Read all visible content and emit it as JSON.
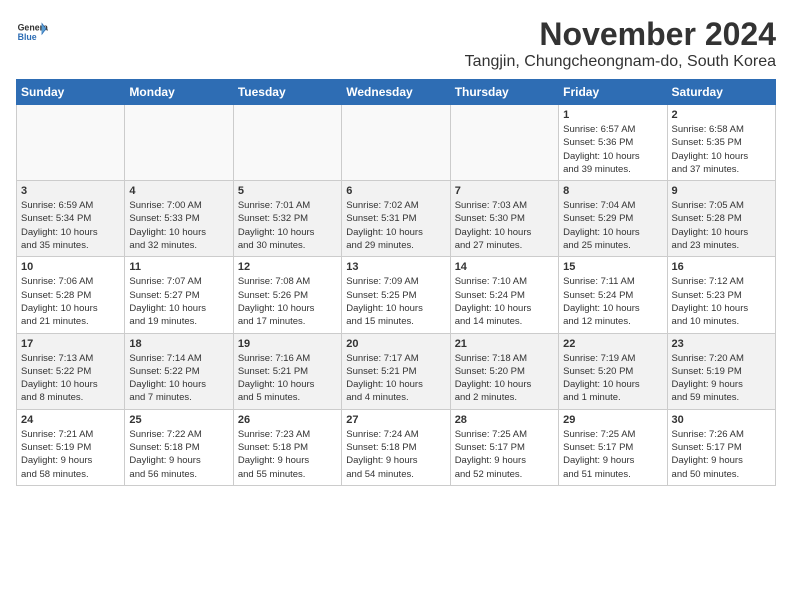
{
  "header": {
    "logo_line1": "General",
    "logo_line2": "Blue",
    "month": "November 2024",
    "location": "Tangjin, Chungcheongnam-do, South Korea"
  },
  "weekdays": [
    "Sunday",
    "Monday",
    "Tuesday",
    "Wednesday",
    "Thursday",
    "Friday",
    "Saturday"
  ],
  "weeks": [
    {
      "row_class": "row-odd",
      "days": [
        {
          "num": "",
          "info": "",
          "empty": true
        },
        {
          "num": "",
          "info": "",
          "empty": true
        },
        {
          "num": "",
          "info": "",
          "empty": true
        },
        {
          "num": "",
          "info": "",
          "empty": true
        },
        {
          "num": "",
          "info": "",
          "empty": true
        },
        {
          "num": "1",
          "info": "Sunrise: 6:57 AM\nSunset: 5:36 PM\nDaylight: 10 hours\nand 39 minutes.",
          "empty": false
        },
        {
          "num": "2",
          "info": "Sunrise: 6:58 AM\nSunset: 5:35 PM\nDaylight: 10 hours\nand 37 minutes.",
          "empty": false
        }
      ]
    },
    {
      "row_class": "row-even",
      "days": [
        {
          "num": "3",
          "info": "Sunrise: 6:59 AM\nSunset: 5:34 PM\nDaylight: 10 hours\nand 35 minutes.",
          "empty": false
        },
        {
          "num": "4",
          "info": "Sunrise: 7:00 AM\nSunset: 5:33 PM\nDaylight: 10 hours\nand 32 minutes.",
          "empty": false
        },
        {
          "num": "5",
          "info": "Sunrise: 7:01 AM\nSunset: 5:32 PM\nDaylight: 10 hours\nand 30 minutes.",
          "empty": false
        },
        {
          "num": "6",
          "info": "Sunrise: 7:02 AM\nSunset: 5:31 PM\nDaylight: 10 hours\nand 29 minutes.",
          "empty": false
        },
        {
          "num": "7",
          "info": "Sunrise: 7:03 AM\nSunset: 5:30 PM\nDaylight: 10 hours\nand 27 minutes.",
          "empty": false
        },
        {
          "num": "8",
          "info": "Sunrise: 7:04 AM\nSunset: 5:29 PM\nDaylight: 10 hours\nand 25 minutes.",
          "empty": false
        },
        {
          "num": "9",
          "info": "Sunrise: 7:05 AM\nSunset: 5:28 PM\nDaylight: 10 hours\nand 23 minutes.",
          "empty": false
        }
      ]
    },
    {
      "row_class": "row-odd",
      "days": [
        {
          "num": "10",
          "info": "Sunrise: 7:06 AM\nSunset: 5:28 PM\nDaylight: 10 hours\nand 21 minutes.",
          "empty": false
        },
        {
          "num": "11",
          "info": "Sunrise: 7:07 AM\nSunset: 5:27 PM\nDaylight: 10 hours\nand 19 minutes.",
          "empty": false
        },
        {
          "num": "12",
          "info": "Sunrise: 7:08 AM\nSunset: 5:26 PM\nDaylight: 10 hours\nand 17 minutes.",
          "empty": false
        },
        {
          "num": "13",
          "info": "Sunrise: 7:09 AM\nSunset: 5:25 PM\nDaylight: 10 hours\nand 15 minutes.",
          "empty": false
        },
        {
          "num": "14",
          "info": "Sunrise: 7:10 AM\nSunset: 5:24 PM\nDaylight: 10 hours\nand 14 minutes.",
          "empty": false
        },
        {
          "num": "15",
          "info": "Sunrise: 7:11 AM\nSunset: 5:24 PM\nDaylight: 10 hours\nand 12 minutes.",
          "empty": false
        },
        {
          "num": "16",
          "info": "Sunrise: 7:12 AM\nSunset: 5:23 PM\nDaylight: 10 hours\nand 10 minutes.",
          "empty": false
        }
      ]
    },
    {
      "row_class": "row-even",
      "days": [
        {
          "num": "17",
          "info": "Sunrise: 7:13 AM\nSunset: 5:22 PM\nDaylight: 10 hours\nand 8 minutes.",
          "empty": false
        },
        {
          "num": "18",
          "info": "Sunrise: 7:14 AM\nSunset: 5:22 PM\nDaylight: 10 hours\nand 7 minutes.",
          "empty": false
        },
        {
          "num": "19",
          "info": "Sunrise: 7:16 AM\nSunset: 5:21 PM\nDaylight: 10 hours\nand 5 minutes.",
          "empty": false
        },
        {
          "num": "20",
          "info": "Sunrise: 7:17 AM\nSunset: 5:21 PM\nDaylight: 10 hours\nand 4 minutes.",
          "empty": false
        },
        {
          "num": "21",
          "info": "Sunrise: 7:18 AM\nSunset: 5:20 PM\nDaylight: 10 hours\nand 2 minutes.",
          "empty": false
        },
        {
          "num": "22",
          "info": "Sunrise: 7:19 AM\nSunset: 5:20 PM\nDaylight: 10 hours\nand 1 minute.",
          "empty": false
        },
        {
          "num": "23",
          "info": "Sunrise: 7:20 AM\nSunset: 5:19 PM\nDaylight: 9 hours\nand 59 minutes.",
          "empty": false
        }
      ]
    },
    {
      "row_class": "row-odd",
      "days": [
        {
          "num": "24",
          "info": "Sunrise: 7:21 AM\nSunset: 5:19 PM\nDaylight: 9 hours\nand 58 minutes.",
          "empty": false
        },
        {
          "num": "25",
          "info": "Sunrise: 7:22 AM\nSunset: 5:18 PM\nDaylight: 9 hours\nand 56 minutes.",
          "empty": false
        },
        {
          "num": "26",
          "info": "Sunrise: 7:23 AM\nSunset: 5:18 PM\nDaylight: 9 hours\nand 55 minutes.",
          "empty": false
        },
        {
          "num": "27",
          "info": "Sunrise: 7:24 AM\nSunset: 5:18 PM\nDaylight: 9 hours\nand 54 minutes.",
          "empty": false
        },
        {
          "num": "28",
          "info": "Sunrise: 7:25 AM\nSunset: 5:17 PM\nDaylight: 9 hours\nand 52 minutes.",
          "empty": false
        },
        {
          "num": "29",
          "info": "Sunrise: 7:25 AM\nSunset: 5:17 PM\nDaylight: 9 hours\nand 51 minutes.",
          "empty": false
        },
        {
          "num": "30",
          "info": "Sunrise: 7:26 AM\nSunset: 5:17 PM\nDaylight: 9 hours\nand 50 minutes.",
          "empty": false
        }
      ]
    }
  ]
}
